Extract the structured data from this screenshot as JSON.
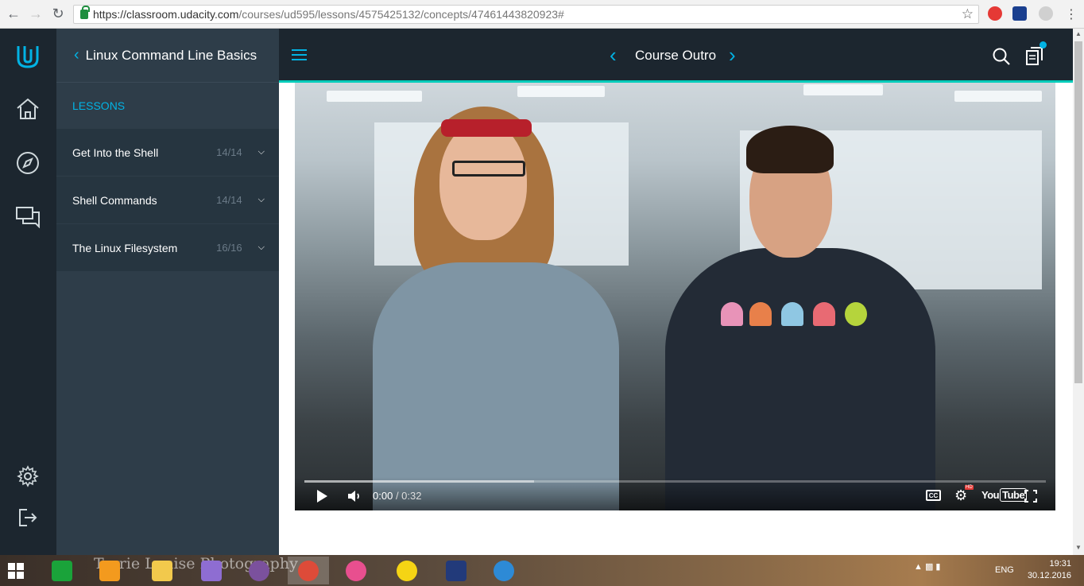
{
  "browser": {
    "url_host": "https://classroom.udacity.com",
    "url_path": "/courses/ud595/lessons/4575425132/concepts/47461443820923#"
  },
  "rail": {
    "icons": [
      "udacity-logo",
      "home-icon",
      "compass-icon",
      "chat-icon",
      "settings-icon",
      "logout-icon"
    ]
  },
  "sidebar": {
    "course_title": "Linux Command Line Basics",
    "lessons_heading": "LESSONS",
    "lessons": [
      {
        "name": "Get Into the Shell",
        "count": "14/14"
      },
      {
        "name": "Shell Commands",
        "count": "14/14"
      },
      {
        "name": "The Linux Filesystem",
        "count": "16/16"
      }
    ]
  },
  "header": {
    "concept_title": "Course Outro"
  },
  "video": {
    "current_time": "0:00",
    "duration": "/ 0:32",
    "cc_label": "CC",
    "hd_label": "HD",
    "youtube_label": "You",
    "youtube_tube": "Tube",
    "buffered_fraction": 0.31,
    "shirt_colors": [
      "#e893b8",
      "#e8804a",
      "#8fc7e3",
      "#e86a73",
      "#b5d43c"
    ]
  },
  "taskbar": {
    "watermark": "Torrie Louise Photography",
    "apps": [
      {
        "name": "store",
        "color": "#1aa33a"
      },
      {
        "name": "media-player",
        "color": "#f39a1e"
      },
      {
        "name": "file-explorer",
        "color": "#f2c94c"
      },
      {
        "name": "visual-studio",
        "color": "#8e6dd2"
      },
      {
        "name": "viber",
        "color": "#7b519d"
      },
      {
        "name": "chrome",
        "color": "#dd4b39"
      },
      {
        "name": "color-wheel",
        "color": "#e84f8f"
      },
      {
        "name": "smiley",
        "color": "#f5d414"
      },
      {
        "name": "moon-app",
        "color": "#223a7a"
      },
      {
        "name": "safari",
        "color": "#2d8ad6"
      }
    ],
    "lang": "ENG",
    "time": "19:31",
    "date": "30.12.2016"
  },
  "colors": {
    "accent": "#02b3e4",
    "teal": "#02ccba",
    "rail_bg": "#1c262f",
    "sidebar_bg": "#2e3d49"
  }
}
